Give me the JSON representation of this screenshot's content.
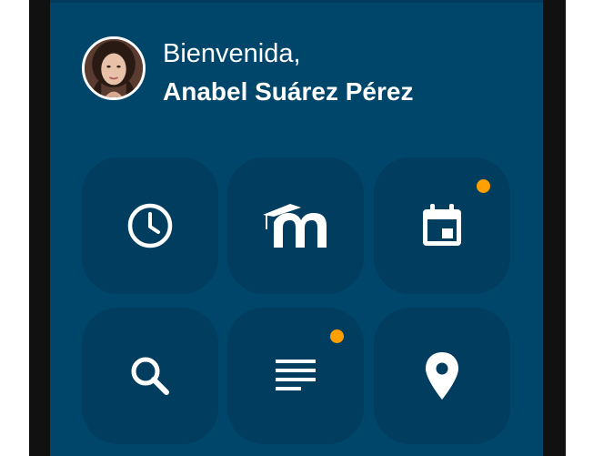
{
  "header": {
    "greeting": "Bienvenida,",
    "user_name": "Anabel Suárez Pérez"
  },
  "tiles": [
    {
      "id": "recent",
      "icon": "clock-icon",
      "badge": false
    },
    {
      "id": "moodle",
      "icon": "moodle-logo-icon",
      "badge": false
    },
    {
      "id": "calendar",
      "icon": "calendar-icon",
      "badge": true
    },
    {
      "id": "search",
      "icon": "search-icon",
      "badge": false
    },
    {
      "id": "notes",
      "icon": "notes-icon",
      "badge": true
    },
    {
      "id": "location",
      "icon": "location-pin-icon",
      "badge": false
    }
  ],
  "colors": {
    "screen_bg": "#00466b",
    "tile_bg": "#003d5e",
    "badge": "#ffa000",
    "icon": "#ffffff"
  }
}
